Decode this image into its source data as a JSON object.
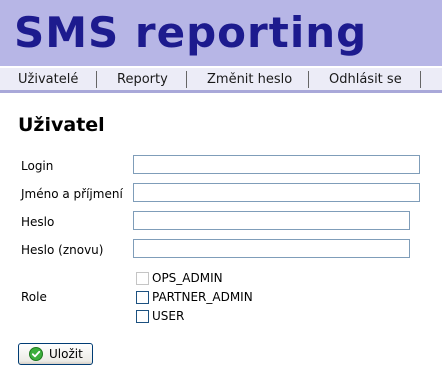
{
  "header": {
    "app_title": "SMS reporting"
  },
  "nav": {
    "items": [
      {
        "label": "Uživatelé"
      },
      {
        "label": "Reporty"
      },
      {
        "label": "Změnit heslo"
      },
      {
        "label": "Odhlásit se"
      }
    ]
  },
  "form": {
    "title": "Uživatel",
    "fields": {
      "login": {
        "label": "Login",
        "value": ""
      },
      "full_name": {
        "label": "Jméno a příjmení",
        "value": ""
      },
      "password": {
        "label": "Heslo",
        "value": ""
      },
      "password_again": {
        "label": "Heslo (znovu)",
        "value": ""
      }
    },
    "role": {
      "label": "Role",
      "options": [
        {
          "label": "OPS_ADMIN",
          "checked": false,
          "disabled": true
        },
        {
          "label": "PARTNER_ADMIN",
          "checked": false,
          "disabled": false
        },
        {
          "label": "USER",
          "checked": false,
          "disabled": false
        }
      ]
    },
    "save_label": "Uložit"
  },
  "colors": {
    "header_bg": "#b7b6e6",
    "title_color": "#1d1b8e",
    "nav_bg": "#ececf7",
    "nav_border": "#a9a8d9",
    "input_border": "#7f9db9",
    "ok_icon": "#3cae3c"
  },
  "icons": {
    "save": "check-circle-icon"
  }
}
